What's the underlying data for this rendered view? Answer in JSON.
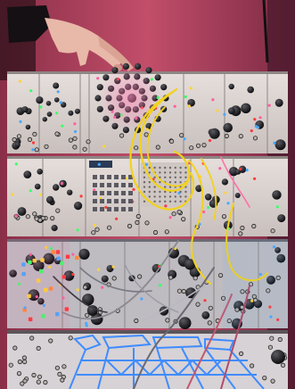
{
  "photo": {
    "subject": "modular-synthesizer",
    "colors": {
      "wall": "#b0455e",
      "wall_dark": "#5a1e34",
      "panel": "#d9d4d0",
      "panel_shadow": "#a7a19f",
      "knob": "#1c1c20",
      "cable_yellow": "#f2d21a",
      "cable_gray": "#8a8a90",
      "keyboard_line": "#3f8cff",
      "glow_pink": "#ff5fa0",
      "led_red": "#ff3a3a",
      "led_green": "#3cff6a",
      "led_blue": "#4aa8ff",
      "led_yellow": "#ffd23a"
    }
  }
}
